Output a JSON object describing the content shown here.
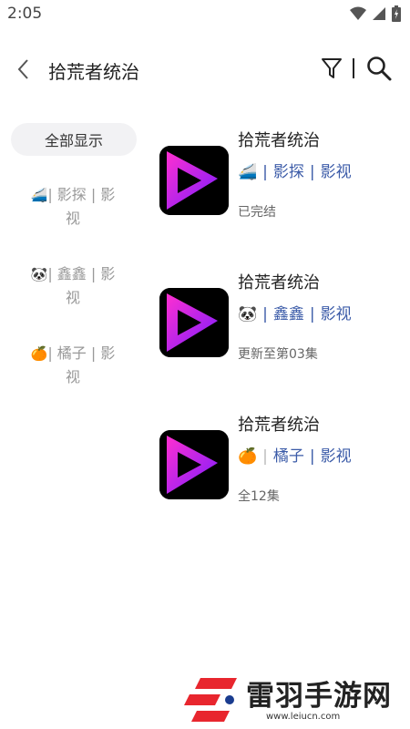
{
  "status_bar": {
    "time": "2:05"
  },
  "header": {
    "title": "拾荒者统治"
  },
  "sidebar": {
    "active": "全部显示",
    "items": [
      {
        "emoji": "🚄",
        "line1": "| 影探 | 影",
        "line2": "视"
      },
      {
        "emoji": "🐼",
        "line1": "| 鑫鑫 | 影",
        "line2": "视"
      },
      {
        "emoji": "🍊",
        "line1": "| 橘子 | 影",
        "line2": "视"
      }
    ]
  },
  "results": [
    {
      "title": "拾荒者统治",
      "emoji": "🚄",
      "source_name": "影探",
      "source_type": "影视",
      "status": "已完结"
    },
    {
      "title": "拾荒者统治",
      "emoji": "🐼",
      "source_name": "鑫鑫",
      "source_type": "影视",
      "status": "更新至第03集"
    },
    {
      "title": "拾荒者统治",
      "emoji": "🍊",
      "source_name": "橘子",
      "source_type": "影视",
      "status": "全12集"
    }
  ],
  "watermark": {
    "text": "雷羽手游网",
    "url": "www.leiucn.com"
  },
  "colors": {
    "accent": "#3b5ba8",
    "poster_gradient_start": "#ff2fd0",
    "poster_gradient_end": "#7a1cff"
  }
}
